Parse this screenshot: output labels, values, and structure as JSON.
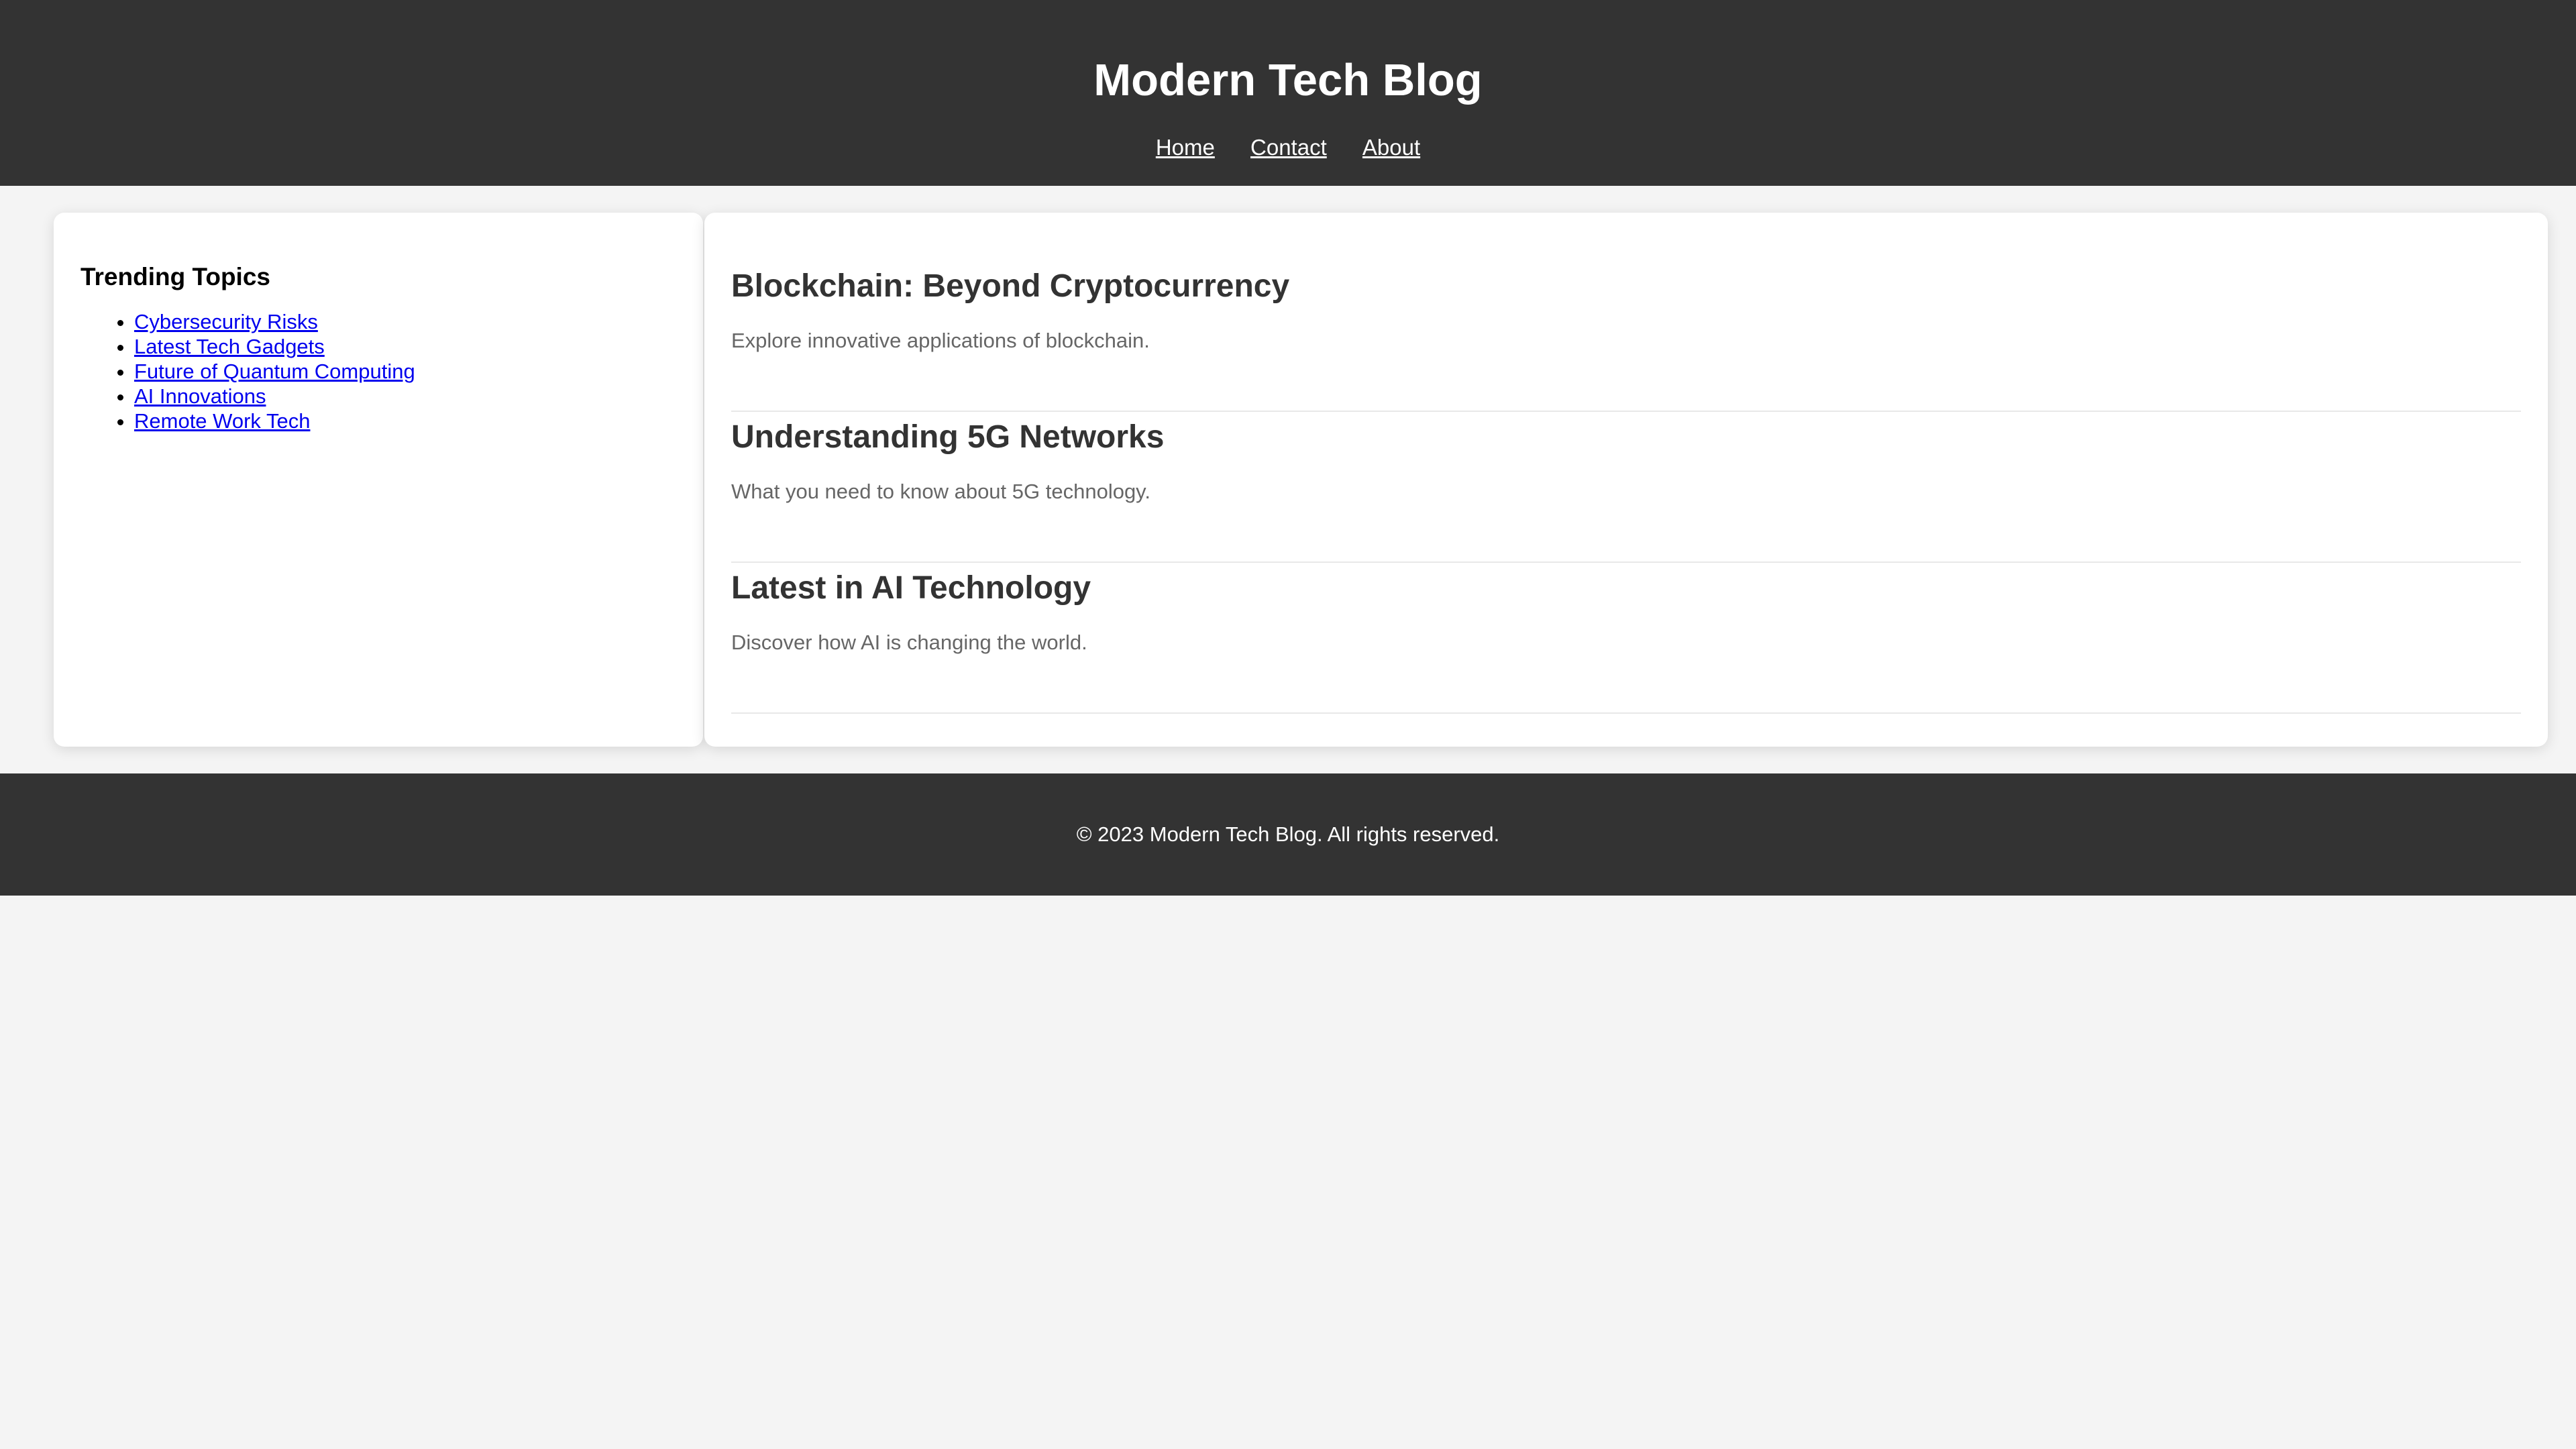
{
  "header": {
    "title": "Modern Tech Blog",
    "nav": [
      {
        "label": "Home"
      },
      {
        "label": "Contact"
      },
      {
        "label": "About"
      }
    ]
  },
  "sidebar": {
    "title": "Trending Topics",
    "topics": [
      {
        "label": "Cybersecurity Risks"
      },
      {
        "label": "Latest Tech Gadgets"
      },
      {
        "label": "Future of Quantum Computing"
      },
      {
        "label": "AI Innovations"
      },
      {
        "label": "Remote Work Tech"
      }
    ]
  },
  "articles": [
    {
      "title": "Blockchain: Beyond Cryptocurrency",
      "description": "Explore innovative applications of blockchain."
    },
    {
      "title": "Understanding 5G Networks",
      "description": "What you need to know about 5G technology."
    },
    {
      "title": "Latest in AI Technology",
      "description": "Discover how AI is changing the world."
    }
  ],
  "footer": {
    "text": "© 2023 Modern Tech Blog. All rights reserved."
  },
  "colors": {
    "header_bg": "#333333",
    "page_bg": "#f4f4f4",
    "link": "#0000ee",
    "heading": "#333333",
    "muted_text": "#666666"
  }
}
